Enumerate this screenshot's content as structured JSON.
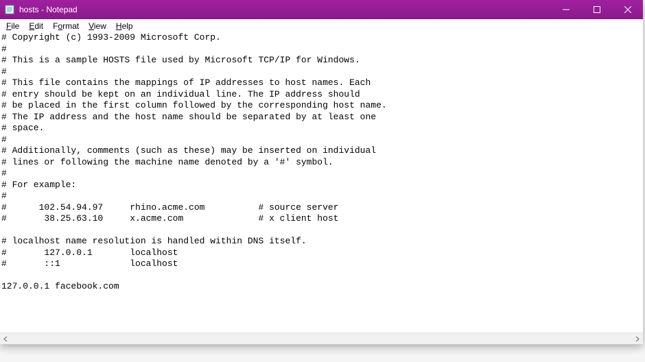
{
  "titlebar": {
    "title": "hosts - Notepad"
  },
  "menubar": {
    "items": [
      {
        "label": "File",
        "accel": "F"
      },
      {
        "label": "Edit",
        "accel": "E"
      },
      {
        "label": "Format",
        "accel": "o"
      },
      {
        "label": "View",
        "accel": "V"
      },
      {
        "label": "Help",
        "accel": "H"
      }
    ]
  },
  "editor": {
    "content": "# Copyright (c) 1993-2009 Microsoft Corp.\n#\n# This is a sample HOSTS file used by Microsoft TCP/IP for Windows.\n#\n# This file contains the mappings of IP addresses to host names. Each\n# entry should be kept on an individual line. The IP address should\n# be placed in the first column followed by the corresponding host name.\n# The IP address and the host name should be separated by at least one\n# space.\n#\n# Additionally, comments (such as these) may be inserted on individual\n# lines or following the machine name denoted by a '#' symbol.\n#\n# For example:\n#\n#      102.54.94.97     rhino.acme.com          # source server\n#       38.25.63.10     x.acme.com              # x client host\n\n# localhost name resolution is handled within DNS itself.\n#       127.0.0.1       localhost\n#       ::1             localhost\n\n127.0.0.1 facebook.com"
  }
}
